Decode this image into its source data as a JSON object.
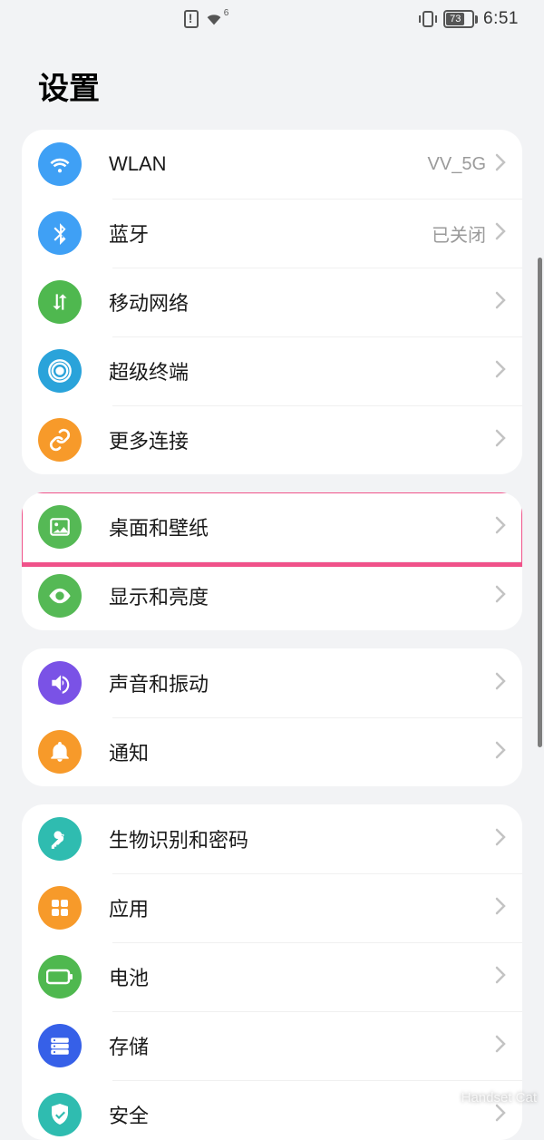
{
  "status_bar": {
    "wifi_gen": "6",
    "battery_percent": "73",
    "time": "6:51"
  },
  "page_title": "设置",
  "groups": [
    {
      "rows": [
        {
          "id": "wlan",
          "label": "WLAN",
          "value": "VV_5G",
          "icon": "wifi",
          "color": "#3fa0f5"
        },
        {
          "id": "bluetooth",
          "label": "蓝牙",
          "value": "已关闭",
          "icon": "bluetooth",
          "color": "#3fa0f5"
        },
        {
          "id": "mobile-network",
          "label": "移动网络",
          "value": "",
          "icon": "updown",
          "color": "#4fb84f"
        },
        {
          "id": "super-device",
          "label": "超级终端",
          "value": "",
          "icon": "radar",
          "color": "#2aa3da"
        },
        {
          "id": "more-connections",
          "label": "更多连接",
          "value": "",
          "icon": "link",
          "color": "#f79a2a"
        }
      ]
    },
    {
      "rows": [
        {
          "id": "home-wallpaper",
          "label": "桌面和壁纸",
          "value": "",
          "icon": "picture",
          "color": "#55b955",
          "highlighted": true
        },
        {
          "id": "display-brightness",
          "label": "显示和亮度",
          "value": "",
          "icon": "eye",
          "color": "#55b955"
        }
      ]
    },
    {
      "rows": [
        {
          "id": "sound-vibration",
          "label": "声音和振动",
          "value": "",
          "icon": "volume",
          "color": "#7a52e6"
        },
        {
          "id": "notifications",
          "label": "通知",
          "value": "",
          "icon": "bell",
          "color": "#f79a2a"
        }
      ]
    },
    {
      "rows": [
        {
          "id": "biometrics-password",
          "label": "生物识别和密码",
          "value": "",
          "icon": "key",
          "color": "#2fbcb0"
        },
        {
          "id": "apps",
          "label": "应用",
          "value": "",
          "icon": "grid",
          "color": "#f79a2a"
        },
        {
          "id": "battery",
          "label": "电池",
          "value": "",
          "icon": "battery",
          "color": "#4fb84f"
        },
        {
          "id": "storage",
          "label": "存储",
          "value": "",
          "icon": "storage",
          "color": "#3660e8"
        },
        {
          "id": "security",
          "label": "安全",
          "value": "",
          "icon": "shield",
          "color": "#2fbcb0"
        }
      ]
    }
  ],
  "watermark": "Handset Cat"
}
